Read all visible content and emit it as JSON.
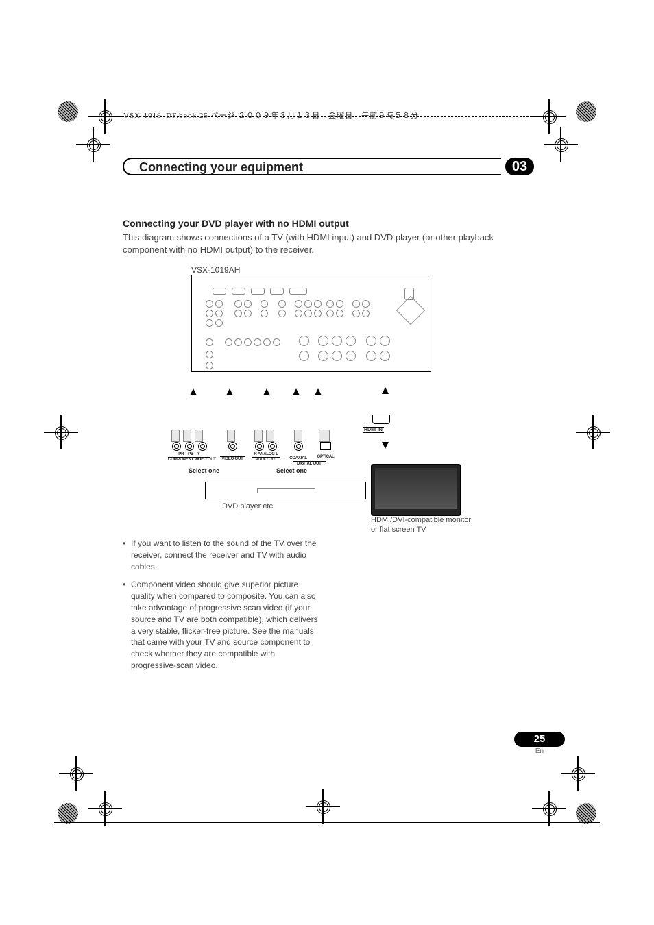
{
  "header_print_info": "VSX-1019_DF.book  25 ページ  ２００９年３月１３日　金曜日　午前９時５８分",
  "section": {
    "title": "Connecting your equipment",
    "number": "03"
  },
  "subsection": {
    "heading": "Connecting your DVD player with no HDMI output",
    "intro": "This diagram shows connections of a TV (with HDMI input) and DVD player (or other playback component with no HDMI output) to the receiver."
  },
  "diagram": {
    "model": "VSX-1019AH",
    "dvd_caption": "DVD player etc.",
    "tv_caption_line1": "HDMI/DVI-compatible monitor",
    "tv_caption_line2": "or flat screen TV",
    "hdmi_in": "HDMI IN",
    "group1": {
      "labels": [
        "PR",
        "PB",
        "Y"
      ],
      "row": "COMPONENT VIDEO OUT",
      "select": "Select one"
    },
    "group2": {
      "row": "VIDEO OUT"
    },
    "group3": {
      "labels": [
        "R",
        "ANALOG",
        "L"
      ],
      "row": "AUDIO OUT",
      "select": "Select one"
    },
    "group4": {
      "row": "COAXIAL"
    },
    "group5": {
      "row": "OPTICAL",
      "row2": "DIGITAL OUT"
    }
  },
  "bullets": [
    "If you want to listen to the sound of the TV over the receiver, connect the receiver and TV with audio cables.",
    "Component video should give superior picture quality when compared to composite. You can also take advantage of progressive scan video (if your source and TV are both compatible), which delivers a very stable, flicker-free picture. See the manuals that came with your TV and source component to check whether they are compatible with progressive-scan video."
  ],
  "page": {
    "number": "25",
    "lang": "En"
  }
}
